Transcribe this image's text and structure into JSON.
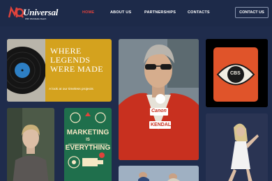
{
  "brand": {
    "logo_mark": "NQ",
    "name": "Universal",
    "tagline": "With Worldwide Reach"
  },
  "nav": {
    "items": [
      {
        "label": "HOME",
        "active": true
      },
      {
        "label": "ABOUT US",
        "active": false
      },
      {
        "label": "PARTNERSHIPS",
        "active": false
      },
      {
        "label": "CONTACTS",
        "active": false
      }
    ],
    "cta_label": "CONTACT US"
  },
  "hero": {
    "title_lines": [
      "WHERE",
      "LEGENDS",
      "WERE MADE"
    ],
    "subtitle": "A look at our timeless projects"
  },
  "marketing_poster": {
    "lines": [
      "MARKETING",
      "IS",
      "EVERYTHING"
    ]
  },
  "cbs_poster": {
    "text": "CBS"
  },
  "racing_photo": {
    "patches": [
      "Canon",
      "KENDALL"
    ]
  },
  "colors": {
    "background": "#1f2c4c",
    "accent_red": "#e0433c",
    "hero_gold": "#d4a21e",
    "poster_green": "#1f6f4c",
    "cbs_orange": "#e0542a"
  }
}
